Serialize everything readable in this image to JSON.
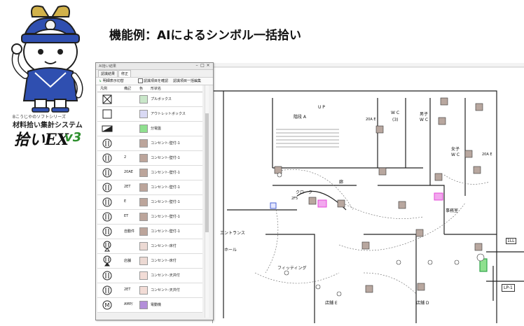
{
  "headline": "機能例：AIによるシンボル一括拾い",
  "logo": {
    "subtitle": "Bこうじやのソフトシリーズ",
    "name": "材料拾い集計システム",
    "brand": "拾いEX",
    "version": "v3"
  },
  "panel": {
    "title": "AI拾い結果",
    "tabs": [
      "認識結果",
      "修正"
    ],
    "toolbar": {
      "display_toggle": "明細表示切替",
      "confirm_checkbox": "認識項目を確認",
      "bulk_edit": "認識項目一括編集"
    },
    "columns": [
      "凡例",
      "備記",
      "色",
      "形状名"
    ],
    "rows": [
      {
        "note": "",
        "color": "#c9e7c9",
        "name": "プルボックス",
        "symbol": "box-cross"
      },
      {
        "note": "",
        "color": "#d9d9f4",
        "name": "アウトレットボックス",
        "symbol": "box-empty"
      },
      {
        "note": "",
        "color": "#8fe08f",
        "name": "分電盤",
        "symbol": "panel-board"
      },
      {
        "note": "",
        "color": "#bca59b",
        "name": "コンセント-壁付-1",
        "symbol": "outlet"
      },
      {
        "note": "2",
        "color": "#bca59b",
        "name": "コンセント-壁付-1",
        "symbol": "outlet"
      },
      {
        "note": "20AE",
        "color": "#bca59b",
        "name": "コンセント-壁付-1",
        "symbol": "outlet"
      },
      {
        "note": "2ET",
        "color": "#bca59b",
        "name": "コンセント-壁付-1",
        "symbol": "outlet"
      },
      {
        "note": "E",
        "color": "#bca59b",
        "name": "コンセント-壁付-1",
        "symbol": "outlet"
      },
      {
        "note": "ET",
        "color": "#bca59b",
        "name": "コンセント-壁付-1",
        "symbol": "outlet"
      },
      {
        "note": "自動件",
        "color": "#bca59b",
        "name": "コンセント-壁付-1",
        "symbol": "outlet"
      },
      {
        "note": "",
        "color": "#ecd9d3",
        "name": "コンセント-床付",
        "symbol": "floor-outlet"
      },
      {
        "note": "店舗",
        "color": "#ecd9d3",
        "name": "コンセント-床付",
        "symbol": "floor-outlet-filled"
      },
      {
        "note": "",
        "color": "#f2dcd6",
        "name": "コンセント-天井付",
        "symbol": "outlet"
      },
      {
        "note": "2ET",
        "color": "#f2dcd6",
        "name": "コンセント-天井付",
        "symbol": "outlet"
      },
      {
        "note": "AMP/",
        "color": "#b38fd9",
        "name": "電動機",
        "symbol": "motor"
      }
    ]
  },
  "plan": {
    "rooms": [
      "階段 A",
      "U P",
      "W C",
      "(3)",
      "男子",
      "W C",
      "女子",
      "W C",
      "20A E",
      "20A E",
      "廊",
      "クローク",
      "2F5",
      "事務室",
      "エントランス",
      "ホール",
      "フィッティング",
      "店舗 E",
      "店舗 D",
      "LP-1",
      "1LL"
    ],
    "colors": {
      "outlet": "#b8a79f",
      "green": "#2fa34a",
      "pink": "#e548d8",
      "blue": "#4a63d6"
    }
  }
}
